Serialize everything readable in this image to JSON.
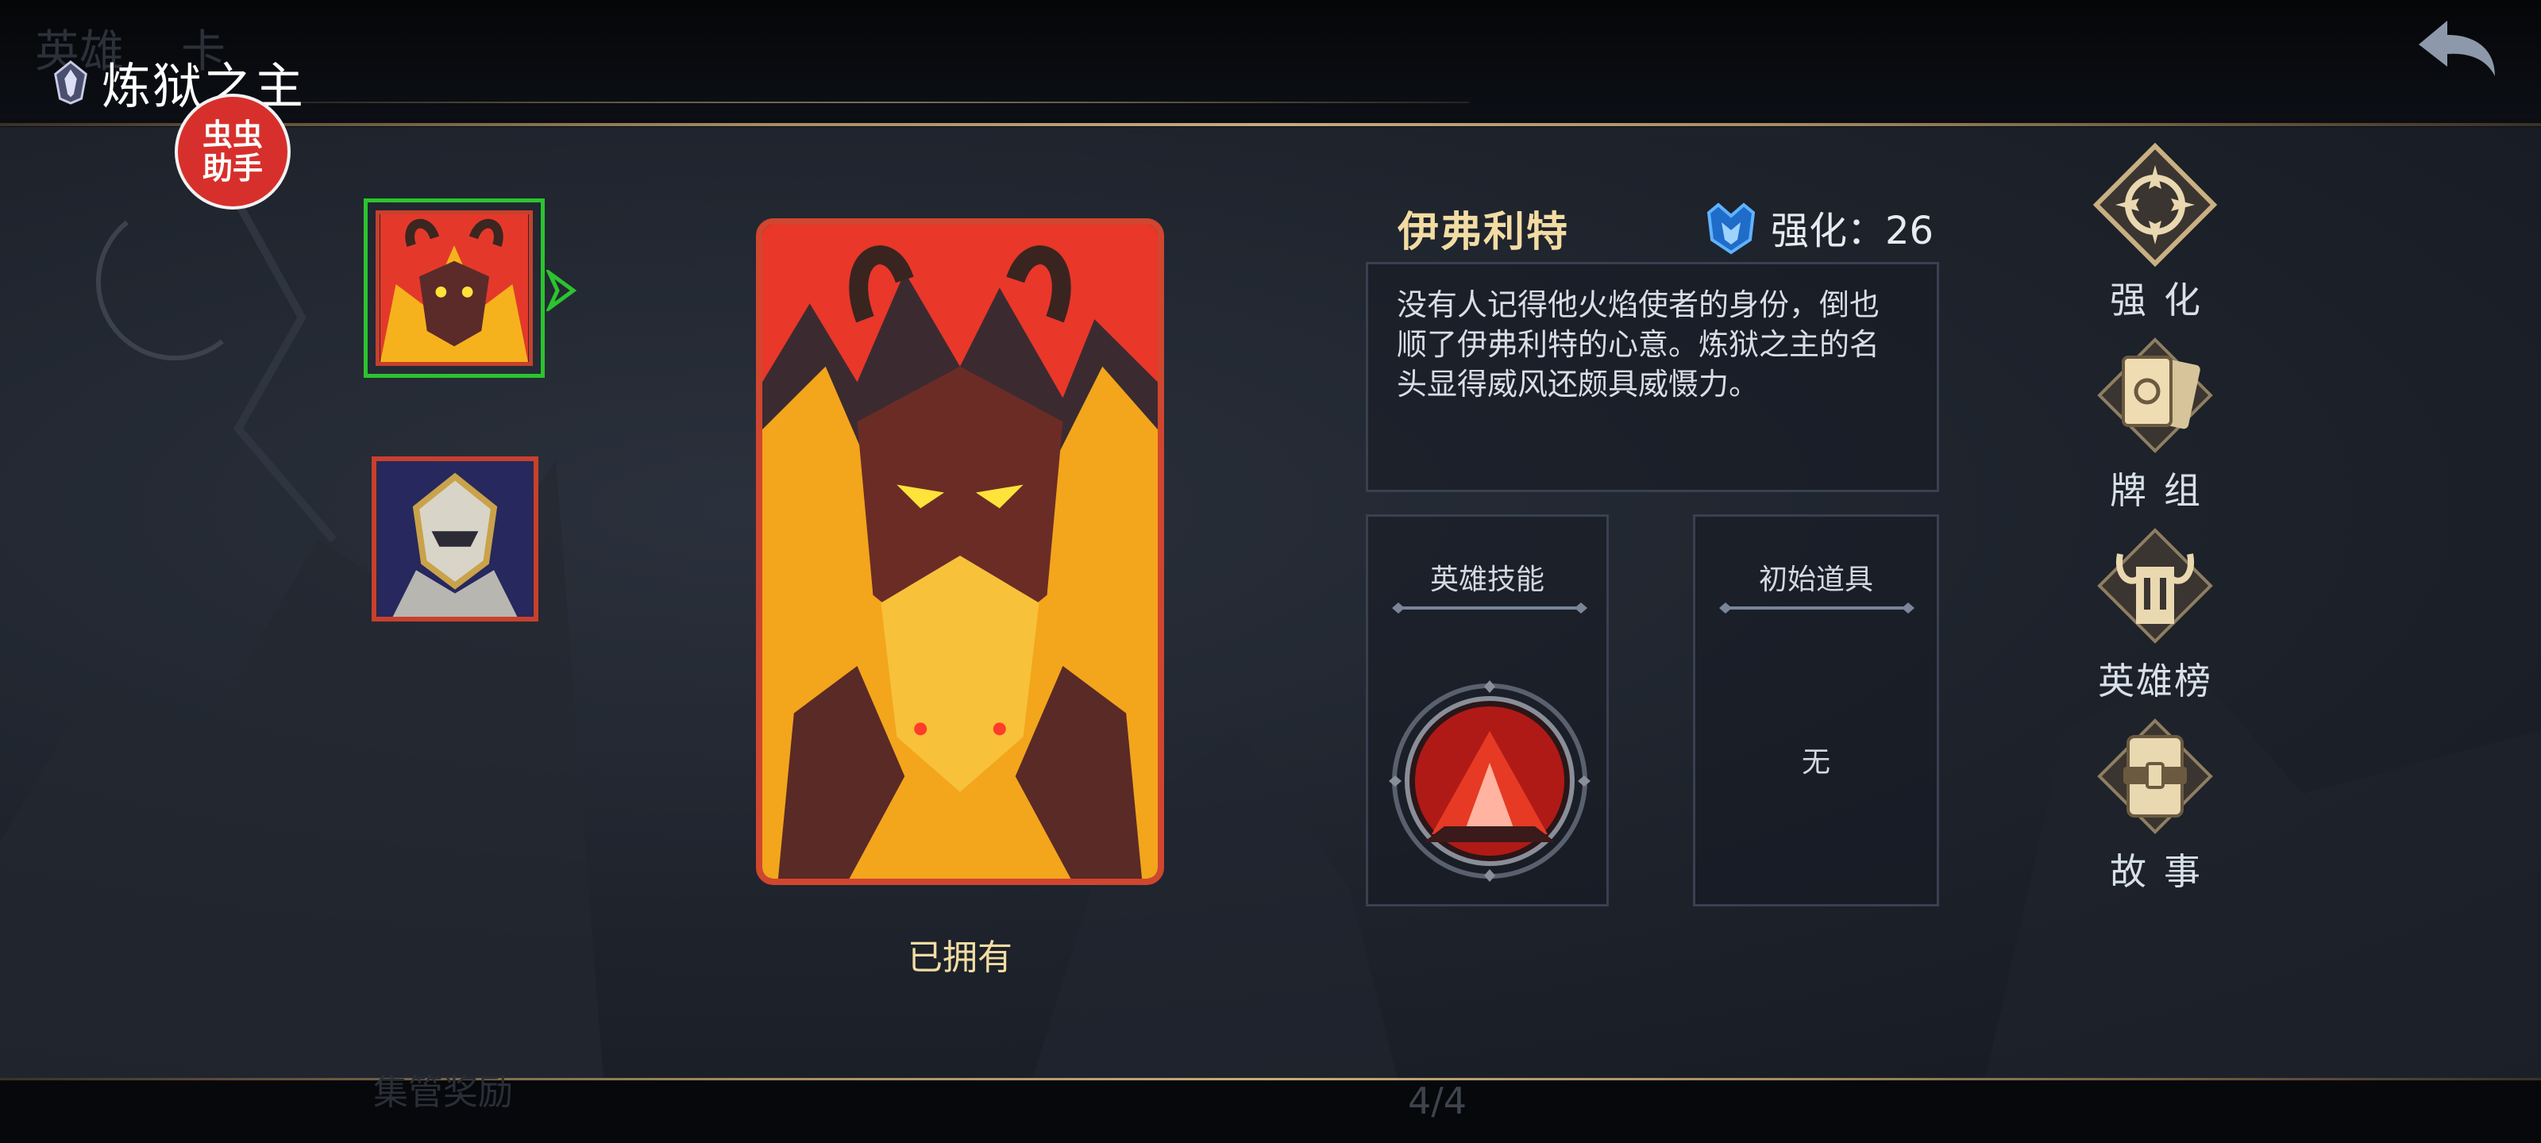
{
  "header": {
    "title": "炼狱之主",
    "ghost_left_a": "英雄",
    "ghost_left_b": "卡",
    "badge_line1": "虫虫",
    "badge_line2": "助手"
  },
  "hero": {
    "name": "伊弗利特",
    "enhance_label": "强化：26",
    "description": "没有人记得他火焰使者的身份，倒也顺了伊弗利特的心意。炼狱之主的名头显得威风还颇具威慑力。",
    "owned_label": "已拥有"
  },
  "panels": {
    "skill_title": "英雄技能",
    "item_title": "初始道具",
    "item_value": "无"
  },
  "side_menu": [
    {
      "label": "强化",
      "icon": "enhance-icon"
    },
    {
      "label": "牌组",
      "icon": "deck-icon"
    },
    {
      "label": "英雄榜",
      "icon": "leaderboard-icon"
    },
    {
      "label": "故事",
      "icon": "story-icon"
    }
  ],
  "footer": {
    "pager": "4/4",
    "ghost_text": "集管奖励"
  },
  "colors": {
    "accent_gold": "#f3dca3",
    "selected_border": "#2bc42e",
    "card_border": "#d0462f",
    "badge_red": "#d7302c"
  }
}
